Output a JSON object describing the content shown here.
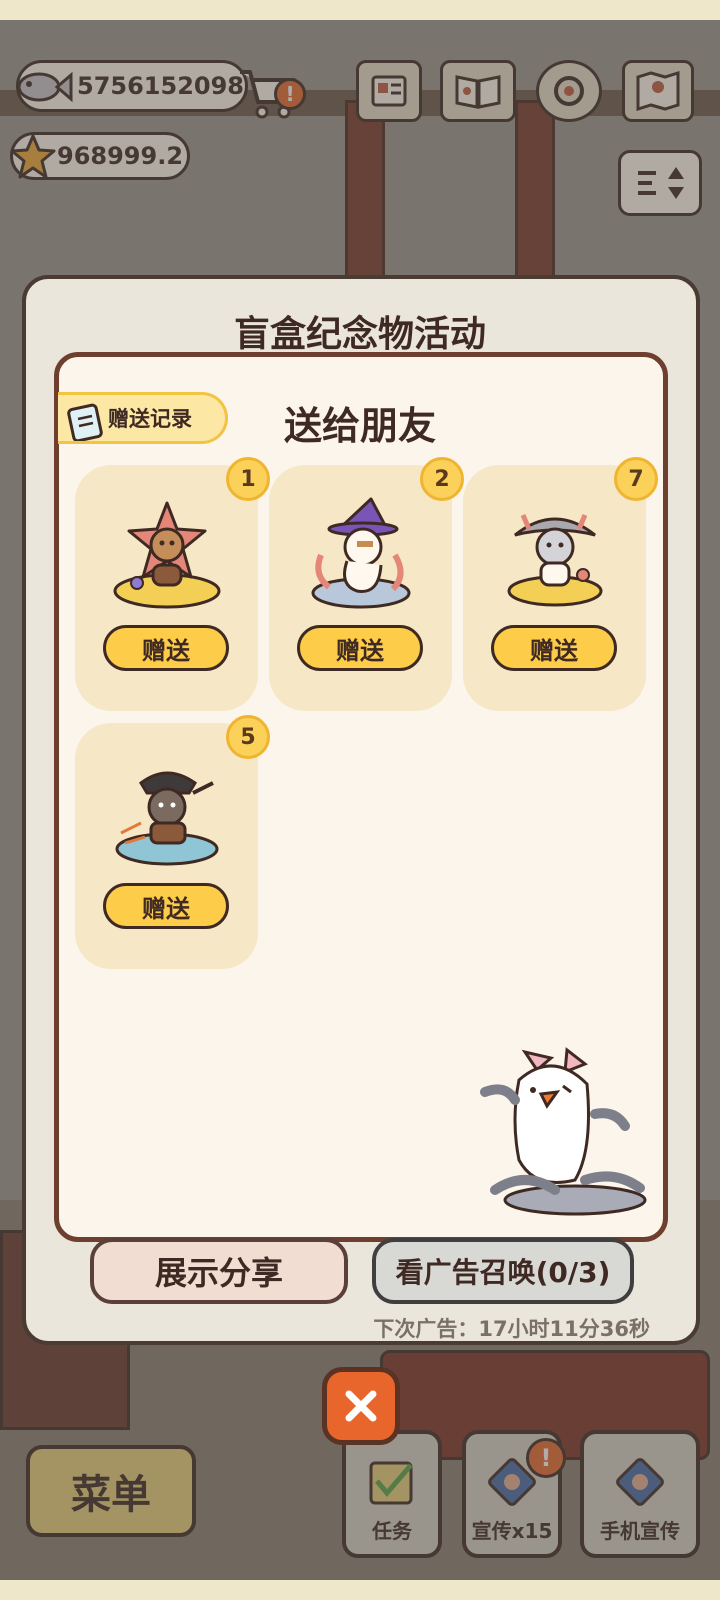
{
  "hud": {
    "fish_count": "5756152098",
    "star_count": "968999.2",
    "cart_alert": "!",
    "icons": [
      "card-icon",
      "book-icon",
      "gear-icon",
      "map-icon",
      "sort-icon"
    ]
  },
  "modal": {
    "outer_title": "盲盒纪念物活动",
    "record_label": "赠送记录",
    "title": "送给朋友",
    "items": [
      {
        "count": "1",
        "give_label": "赠送"
      },
      {
        "count": "2",
        "give_label": "赠送"
      },
      {
        "count": "7",
        "give_label": "赠送"
      },
      {
        "count": "5",
        "give_label": "赠送"
      }
    ],
    "share_label": "展示分享",
    "ad_label": "看广告召唤(0/3)",
    "next_ad": "下次广告：17小时11分36秒",
    "close_icon": "close-icon"
  },
  "bottom": {
    "menu_label": "菜单",
    "task_label": "任务",
    "promo_label": "宣传x15",
    "promo_alert": "!",
    "phone_label": "手机宣传"
  },
  "colors": {
    "accent_yellow": "#fdcd4a",
    "dark_brown": "#3f2a23",
    "close_orange": "#e8652c",
    "card_bg": "#f6e7c6"
  }
}
